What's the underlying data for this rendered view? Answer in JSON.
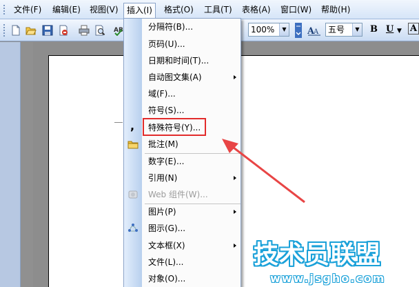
{
  "colors": {
    "accent_box": "#e22b2b",
    "arrow": "#e84545",
    "watermark": "#1aa1d9",
    "menu_bar": "#d6e5f8",
    "menu_gutter": "#b8d0ee"
  },
  "menubar": {
    "items": [
      "文件(F)",
      "编辑(E)",
      "视图(V)",
      "插入(I)",
      "格式(O)",
      "工具(T)",
      "表格(A)",
      "窗口(W)",
      "帮助(H)"
    ],
    "active_item": "插入(I)"
  },
  "toolbar": {
    "zoom": "100%",
    "font_size": "五号",
    "bold": "B",
    "underline": "U",
    "font_color": "A",
    "icons": [
      "new-doc-icon",
      "open-icon",
      "save-icon",
      "permission-icon",
      "print-icon",
      "print-preview-icon",
      "spelling-icon",
      "style-icon"
    ]
  },
  "insert_menu": {
    "items": [
      {
        "label": "分隔符(B)...",
        "submenu": false,
        "disabled": false,
        "icon": ""
      },
      {
        "label": "页码(U)...",
        "submenu": false,
        "disabled": false,
        "icon": ""
      },
      {
        "label": "日期和时间(T)...",
        "submenu": false,
        "disabled": false,
        "icon": ""
      },
      {
        "label": "自动图文集(A)",
        "submenu": true,
        "disabled": false,
        "icon": ""
      },
      {
        "label": "域(F)...",
        "submenu": false,
        "disabled": false,
        "icon": ""
      },
      {
        "label": "符号(S)...",
        "submenu": false,
        "disabled": false,
        "icon": ""
      },
      {
        "label": "特殊符号(Y)...",
        "submenu": false,
        "disabled": false,
        "icon": "comma-icon"
      },
      {
        "label": "批注(M)",
        "submenu": false,
        "disabled": false,
        "icon": "comment-folder-icon"
      },
      {
        "label": "数字(E)...",
        "submenu": false,
        "disabled": false,
        "icon": ""
      },
      {
        "label": "引用(N)",
        "submenu": true,
        "disabled": false,
        "icon": ""
      },
      {
        "label": "Web 组件(W)...",
        "submenu": false,
        "disabled": true,
        "icon": "web-component-icon"
      },
      {
        "label": "图片(P)",
        "submenu": true,
        "disabled": false,
        "icon": ""
      },
      {
        "label": "图示(G)...",
        "submenu": false,
        "disabled": false,
        "icon": "diagram-icon"
      },
      {
        "label": "文本框(X)",
        "submenu": true,
        "disabled": false,
        "icon": ""
      },
      {
        "label": "文件(L)...",
        "submenu": false,
        "disabled": false,
        "icon": ""
      },
      {
        "label": "对象(O)...",
        "submenu": false,
        "disabled": false,
        "icon": ""
      }
    ],
    "highlighted": "特殊符号(Y)..."
  },
  "watermark": {
    "title": "技术员联盟",
    "url": "www.jsgho.com"
  }
}
